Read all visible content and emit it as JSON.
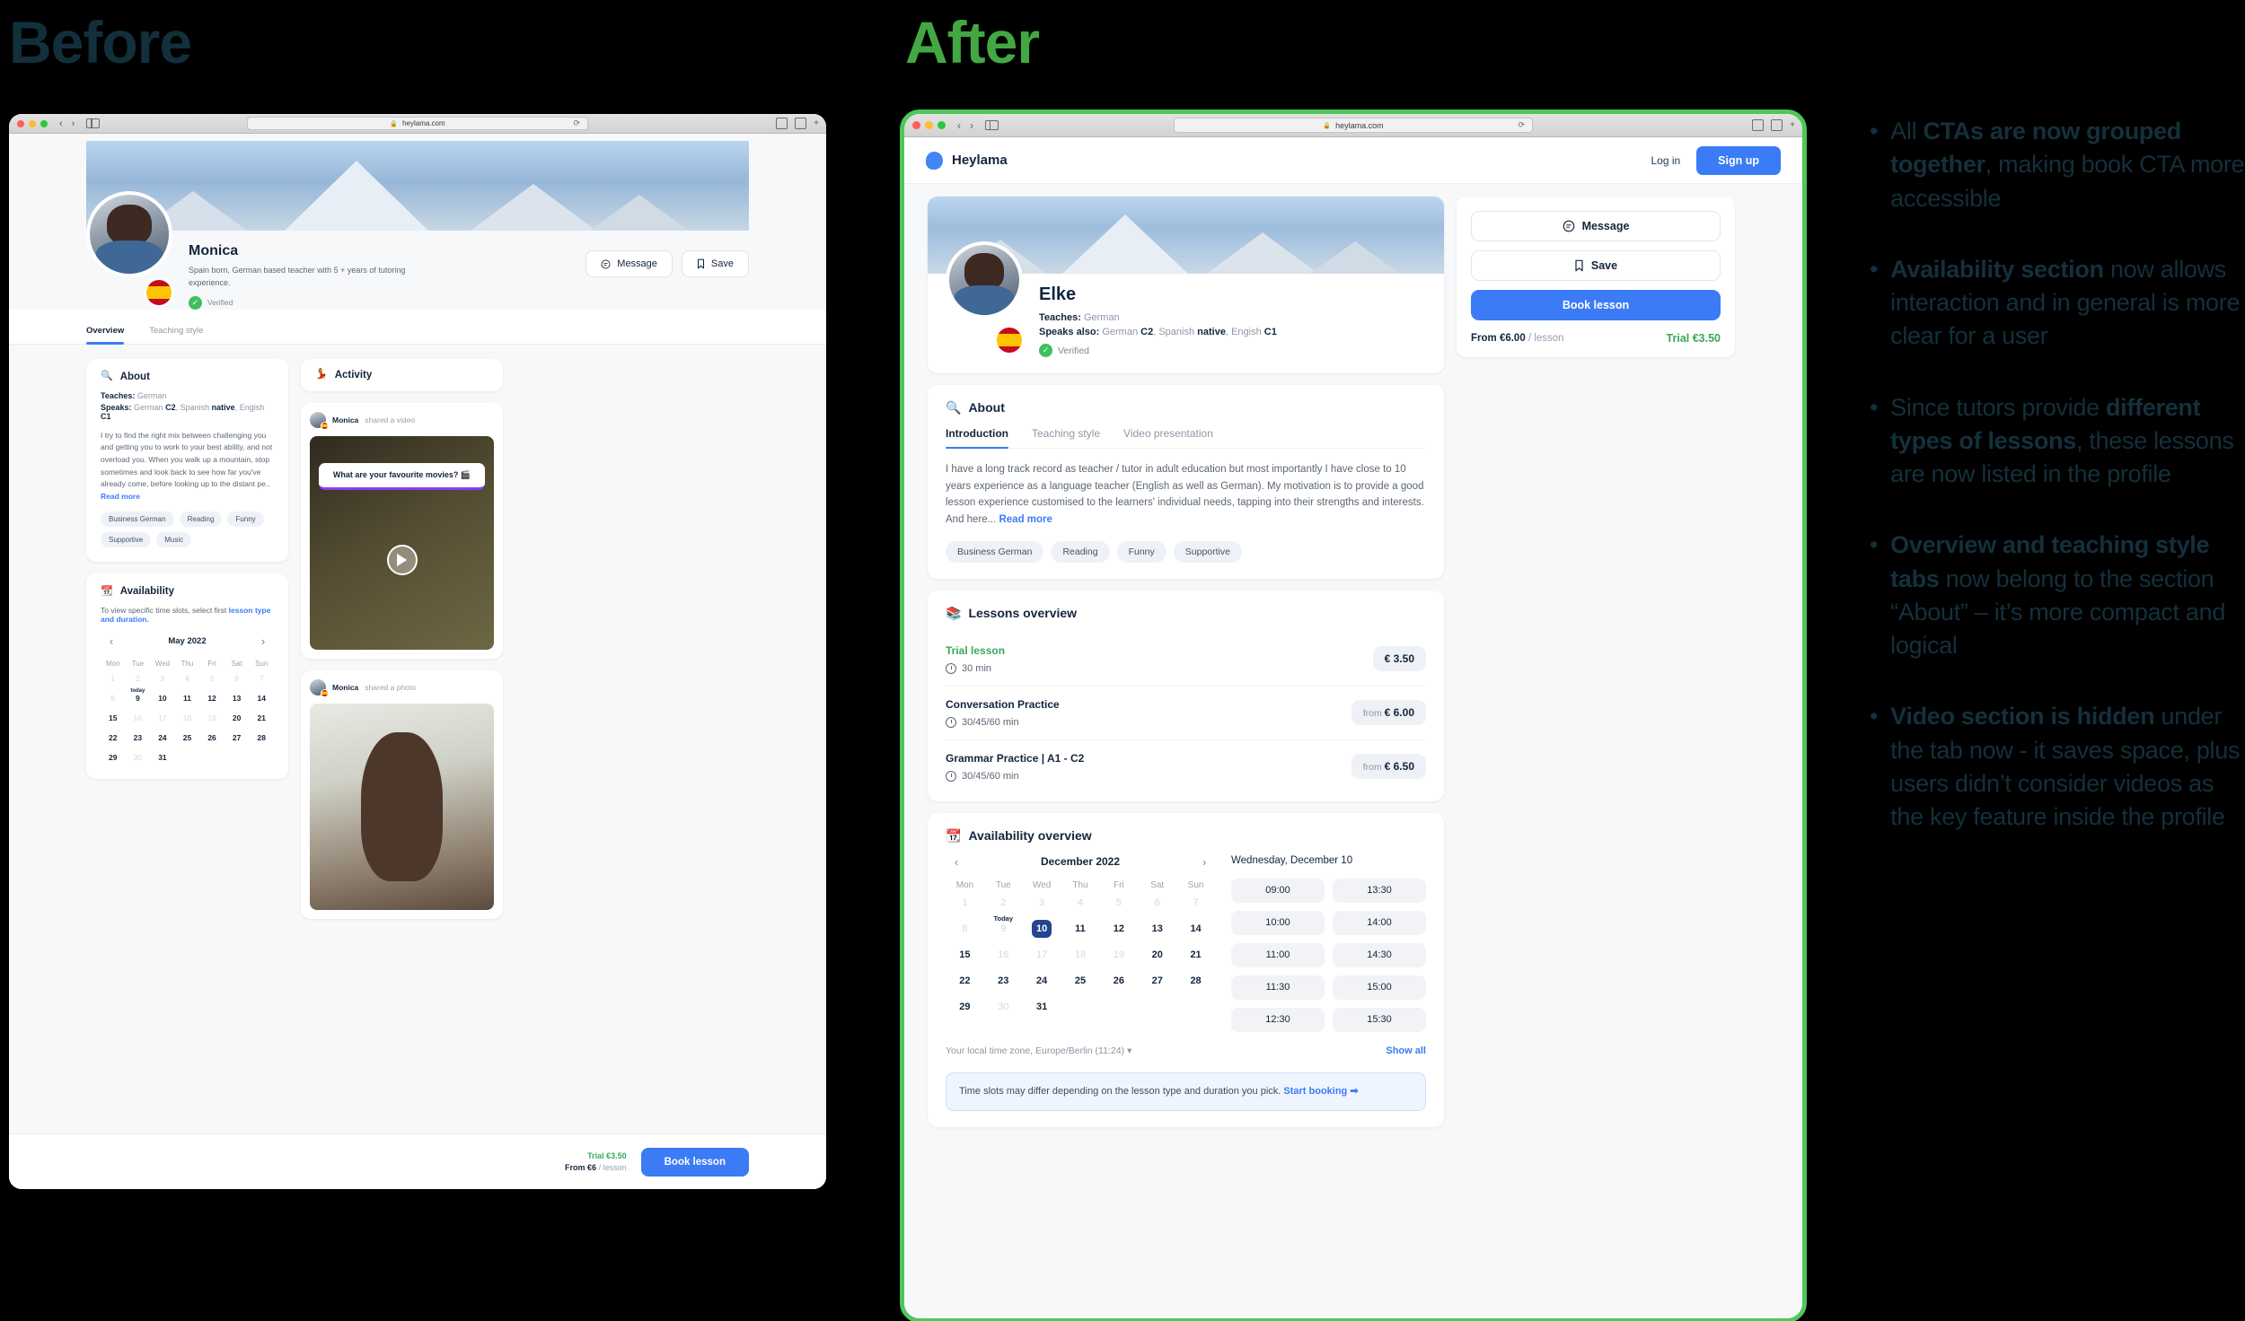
{
  "headings": {
    "before": "Before",
    "after": "After"
  },
  "accent": {
    "green": "#43a843",
    "blue": "#3b7bf6",
    "navy": "#14253d",
    "trial_green": "#3aa85a"
  },
  "browser": {
    "url": "heylama.com",
    "lock_icon": "lock-icon",
    "reload_icon": "reload-icon",
    "back_icon": "chevron-left-icon",
    "forward_icon": "chevron-right-icon",
    "sidebar_icon": "sidebar-toggle-icon",
    "share_icon": "share-icon",
    "tabs_icon": "tabs-icon",
    "newtab_icon": "plus-icon"
  },
  "after": {
    "header": {
      "brand": "Heylama",
      "brand_icon": "heylama-logo-icon",
      "login": "Log in",
      "signup": "Sign up"
    },
    "profile": {
      "name": "Elke",
      "teaches_label": "Teaches:",
      "teaches_value": "German",
      "speaks_label": "Speaks also:",
      "speaks_german": "German",
      "speaks_german_level": "C2",
      "speaks_spanish": "Spanish",
      "speaks_spanish_level": "native",
      "speaks_english": "Engish",
      "speaks_english_level": "C1",
      "verified": "Verified",
      "flag_icon": "spain-flag-icon",
      "verified_icon": "verified-check-icon"
    },
    "cta": {
      "message": "Message",
      "message_icon": "message-icon",
      "save": "Save",
      "save_icon": "bookmark-icon",
      "book": "Book lesson",
      "from_prefix": "From €6.00",
      "from_unit": "/ lesson",
      "trial": "Trial €3.50"
    },
    "about": {
      "title": "About",
      "icon": "magnifier-emoji-icon",
      "tabs": [
        {
          "label": "Introduction",
          "active": true
        },
        {
          "label": "Teaching style",
          "active": false
        },
        {
          "label": "Video presentation",
          "active": false
        }
      ],
      "bio": "I have a long track record as teacher / tutor in adult education but most importantly I have close to 10 years experience as a language teacher (English as well as German). My motivation is to provide a good lesson experience customised to the learners' individual needs, tapping into their strengths and interests. And here...",
      "read_more": "Read more",
      "chips": [
        "Business German",
        "Reading",
        "Funny",
        "Supportive"
      ]
    },
    "lessons": {
      "title": "Lessons overview",
      "icon": "books-emoji-icon",
      "items": [
        {
          "name": "Trial lesson",
          "trial": true,
          "duration": "30 min",
          "price_prefix": "",
          "price": "€ 3.50"
        },
        {
          "name": "Conversation Practice",
          "trial": false,
          "duration": "30/45/60 min",
          "price_prefix": "from",
          "price": "€ 6.00"
        },
        {
          "name": "Grammar Practice  | A1 - C2",
          "trial": false,
          "duration": "30/45/60 min",
          "price_prefix": "from",
          "price": "€ 6.50"
        }
      ]
    },
    "availability": {
      "title": "Availability overview",
      "icon": "calendar-emoji-icon",
      "month": "December 2022",
      "prev_icon": "chevron-left-icon",
      "next_icon": "chevron-right-icon",
      "dow": [
        "Mon",
        "Tue",
        "Wed",
        "Thu",
        "Fri",
        "Sat",
        "Sun"
      ],
      "today_label": "Today",
      "days": [
        {
          "n": "1",
          "state": "dim"
        },
        {
          "n": "2",
          "state": "dim"
        },
        {
          "n": "3",
          "state": "dim"
        },
        {
          "n": "4",
          "state": "dim"
        },
        {
          "n": "5",
          "state": "dim"
        },
        {
          "n": "6",
          "state": "dim"
        },
        {
          "n": "7",
          "state": "dim"
        },
        {
          "n": "8",
          "state": "dim"
        },
        {
          "n": "9",
          "state": "dim",
          "today": true
        },
        {
          "n": "10",
          "state": "sel"
        },
        {
          "n": "11",
          "state": "on"
        },
        {
          "n": "12",
          "state": "on"
        },
        {
          "n": "13",
          "state": "on"
        },
        {
          "n": "14",
          "state": "on"
        },
        {
          "n": "15",
          "state": "on"
        },
        {
          "n": "16",
          "state": "dim"
        },
        {
          "n": "17",
          "state": "dim"
        },
        {
          "n": "18",
          "state": "dim"
        },
        {
          "n": "19",
          "state": "dim"
        },
        {
          "n": "20",
          "state": "on"
        },
        {
          "n": "21",
          "state": "on"
        },
        {
          "n": "22",
          "state": "on"
        },
        {
          "n": "23",
          "state": "on"
        },
        {
          "n": "24",
          "state": "on"
        },
        {
          "n": "25",
          "state": "on"
        },
        {
          "n": "26",
          "state": "on"
        },
        {
          "n": "27",
          "state": "on"
        },
        {
          "n": "28",
          "state": "on"
        },
        {
          "n": "29",
          "state": "on"
        },
        {
          "n": "30",
          "state": "dim"
        },
        {
          "n": "31",
          "state": "on"
        }
      ],
      "selected_date": "Wednesday, December 10",
      "slots": [
        "09:00",
        "13:30",
        "10:00",
        "14:00",
        "11:00",
        "14:30",
        "11:30",
        "15:00",
        "12:30",
        "15:30"
      ],
      "timezone": "Your local time zone, Europe/Berlin (11:24)",
      "timezone_caret": "caret-down-icon",
      "show_all": "Show all",
      "notice_text": "Time slots may differ depending on the lesson type and duration you pick. ",
      "notice_link": "Start booking",
      "notice_link_icon": "arrow-right-box-icon"
    }
  },
  "before": {
    "profile": {
      "name": "Monica",
      "tagline": "Spain born, German based teacher with 5 + years of tutoring experience.",
      "verified": "Verified",
      "flag_icon": "spain-flag-icon",
      "verified_icon": "verified-check-icon"
    },
    "actions": {
      "message": "Message",
      "message_icon": "message-icon",
      "save": "Save",
      "save_icon": "bookmark-icon"
    },
    "tabs": [
      {
        "label": "Overview",
        "active": true
      },
      {
        "label": "Teaching style",
        "active": false
      }
    ],
    "about": {
      "title": "About",
      "icon": "magnifier-emoji-icon",
      "teaches_label": "Teaches:",
      "teaches_value": "German",
      "speaks_label": "Speaks:",
      "speaks_german": "German",
      "speaks_german_level": "C2",
      "speaks_spanish": "Spanish",
      "speaks_spanish_level": "native",
      "speaks_english": "Engish",
      "speaks_english_level": "C1",
      "bio": "I try to find the right mix between challenging you and getting you to work to your best ability, and not overload you. When you walk up a mountain, stop sometimes and look back to see how far you've already come, before looking up to the distant pe..",
      "read_more": "Read more",
      "chips": [
        "Business German",
        "Reading",
        "Funny",
        "Supportive",
        "Music"
      ]
    },
    "availability": {
      "title": "Availability",
      "icon": "calendar-emoji-icon",
      "hint_text": "To view specific time slots, select first ",
      "hint_link": "lesson type and duration.",
      "month": "May 2022",
      "prev_icon": "chevron-left-icon",
      "next_icon": "chevron-right-icon",
      "dow": [
        "Mon",
        "Tue",
        "Wed",
        "Thu",
        "Fri",
        "Sat",
        "Sun"
      ],
      "today_label": "today",
      "days": [
        {
          "n": "1",
          "state": "dim"
        },
        {
          "n": "2",
          "state": "dim"
        },
        {
          "n": "3",
          "state": "dim"
        },
        {
          "n": "4",
          "state": "dim"
        },
        {
          "n": "5",
          "state": "dim"
        },
        {
          "n": "6",
          "state": "dim"
        },
        {
          "n": "7",
          "state": "dim"
        },
        {
          "n": "8",
          "state": "dim"
        },
        {
          "n": "9",
          "state": "on",
          "today": true
        },
        {
          "n": "10",
          "state": "on"
        },
        {
          "n": "11",
          "state": "on"
        },
        {
          "n": "12",
          "state": "on"
        },
        {
          "n": "13",
          "state": "on"
        },
        {
          "n": "14",
          "state": "on"
        },
        {
          "n": "15",
          "state": "on"
        },
        {
          "n": "16",
          "state": "dim"
        },
        {
          "n": "17",
          "state": "dim"
        },
        {
          "n": "18",
          "state": "dim"
        },
        {
          "n": "19",
          "state": "dim"
        },
        {
          "n": "20",
          "state": "on"
        },
        {
          "n": "21",
          "state": "on"
        },
        {
          "n": "22",
          "state": "on"
        },
        {
          "n": "23",
          "state": "on"
        },
        {
          "n": "24",
          "state": "on"
        },
        {
          "n": "25",
          "state": "on"
        },
        {
          "n": "26",
          "state": "on"
        },
        {
          "n": "27",
          "state": "on"
        },
        {
          "n": "28",
          "state": "on"
        },
        {
          "n": "29",
          "state": "on"
        },
        {
          "n": "30",
          "state": "dim"
        },
        {
          "n": "31",
          "state": "on"
        }
      ]
    },
    "activity": {
      "title": "Activity",
      "icon": "dancer-emoji-icon",
      "posts": [
        {
          "user": "Monica",
          "action": "shared a video",
          "caption": "What are your favourite movies? 🎬",
          "type": "video"
        },
        {
          "user": "Monica",
          "action": "shared a photo",
          "caption": "",
          "type": "photo"
        }
      ]
    },
    "bottom_bar": {
      "trial": "Trial €3.50",
      "from_prefix": "From €6",
      "from_unit": "/ lesson",
      "book": "Book lesson"
    }
  },
  "notes": [
    {
      "parts": [
        {
          "t": "All ",
          "b": false
        },
        {
          "t": "CTAs are now grouped together",
          "b": true
        },
        {
          "t": ", making book CTA more accessible",
          "b": false
        }
      ]
    },
    {
      "parts": [
        {
          "t": "Availability section",
          "b": true
        },
        {
          "t": " now allows interaction and in general is more clear for a user",
          "b": false
        }
      ]
    },
    {
      "parts": [
        {
          "t": "Since tutors provide ",
          "b": false
        },
        {
          "t": "different types of lessons",
          "b": true
        },
        {
          "t": ", these lessons are now listed in the profile",
          "b": false
        }
      ]
    },
    {
      "parts": [
        {
          "t": "Overview and teaching style tabs",
          "b": true
        },
        {
          "t": " now belong to the section “About” – it’s more compact and logical",
          "b": false
        }
      ]
    },
    {
      "parts": [
        {
          "t": "Video section is hidden",
          "b": true
        },
        {
          "t": " under the tab now - it saves space, plus users didn’t consider videos as the key feature inside the profile",
          "b": false
        }
      ]
    }
  ]
}
